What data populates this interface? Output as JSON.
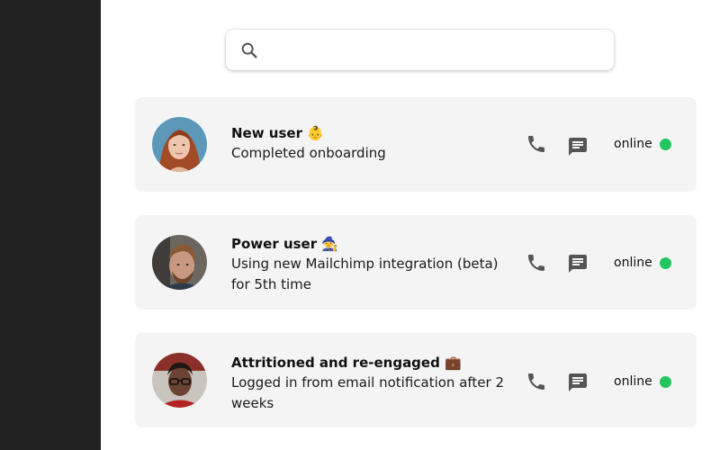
{
  "search": {
    "placeholder": "",
    "value": "",
    "icon": "search-icon"
  },
  "colors": {
    "sidebar": "#212121",
    "card": "#f4f4f4",
    "online": "#22c55e",
    "icon": "#555555"
  },
  "users": [
    {
      "title": "New user 👶",
      "description": "Completed onboarding",
      "status": "online",
      "avatar": "woman-red-hair-photo"
    },
    {
      "title": "Power user 🧙",
      "description": "Using new Mailchimp integration (beta) for 5th time",
      "status": "online",
      "avatar": "man-bearded-photo"
    },
    {
      "title": "Attritioned and re-engaged 💼",
      "description": "Logged in from email notification after 2 weeks",
      "status": "online",
      "avatar": "man-glasses-photo"
    }
  ]
}
